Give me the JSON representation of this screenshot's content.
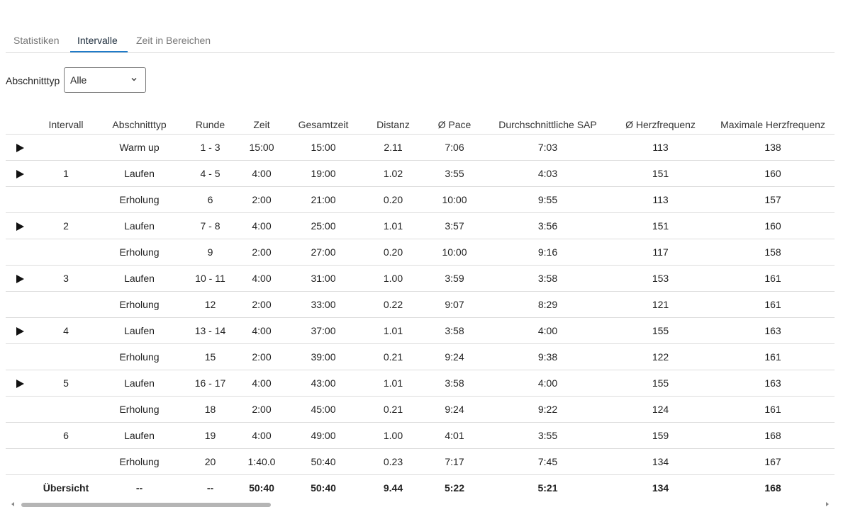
{
  "tabs": [
    {
      "label": "Statistiken",
      "active": false
    },
    {
      "label": "Intervalle",
      "active": true
    },
    {
      "label": "Zeit in Bereichen",
      "active": false
    }
  ],
  "filter": {
    "label": "Abschnitttyp",
    "value": "Alle"
  },
  "table": {
    "headers": [
      "",
      "Intervall",
      "Abschnitttyp",
      "Runde",
      "Zeit",
      "Gesamtzeit",
      "Distanz",
      "Ø Pace",
      "Durchschnittliche SAP",
      "Ø Herzfrequenz",
      "Maximale Herzfrequenz"
    ],
    "rows": [
      {
        "expandable": true,
        "cells": [
          "",
          "Warm up",
          "1 - 3",
          "15:00",
          "15:00",
          "2.11",
          "7:06",
          "7:03",
          "113",
          "138"
        ]
      },
      {
        "expandable": true,
        "cells": [
          "1",
          "Laufen",
          "4 - 5",
          "4:00",
          "19:00",
          "1.02",
          "3:55",
          "4:03",
          "151",
          "160"
        ]
      },
      {
        "expandable": false,
        "cells": [
          "",
          "Erholung",
          "6",
          "2:00",
          "21:00",
          "0.20",
          "10:00",
          "9:55",
          "113",
          "157"
        ]
      },
      {
        "expandable": true,
        "cells": [
          "2",
          "Laufen",
          "7 - 8",
          "4:00",
          "25:00",
          "1.01",
          "3:57",
          "3:56",
          "151",
          "160"
        ]
      },
      {
        "expandable": false,
        "cells": [
          "",
          "Erholung",
          "9",
          "2:00",
          "27:00",
          "0.20",
          "10:00",
          "9:16",
          "117",
          "158"
        ]
      },
      {
        "expandable": true,
        "cells": [
          "3",
          "Laufen",
          "10 - 11",
          "4:00",
          "31:00",
          "1.00",
          "3:59",
          "3:58",
          "153",
          "161"
        ]
      },
      {
        "expandable": false,
        "cells": [
          "",
          "Erholung",
          "12",
          "2:00",
          "33:00",
          "0.22",
          "9:07",
          "8:29",
          "121",
          "161"
        ]
      },
      {
        "expandable": true,
        "cells": [
          "4",
          "Laufen",
          "13 - 14",
          "4:00",
          "37:00",
          "1.01",
          "3:58",
          "4:00",
          "155",
          "163"
        ]
      },
      {
        "expandable": false,
        "cells": [
          "",
          "Erholung",
          "15",
          "2:00",
          "39:00",
          "0.21",
          "9:24",
          "9:38",
          "122",
          "161"
        ]
      },
      {
        "expandable": true,
        "cells": [
          "5",
          "Laufen",
          "16 - 17",
          "4:00",
          "43:00",
          "1.01",
          "3:58",
          "4:00",
          "155",
          "163"
        ]
      },
      {
        "expandable": false,
        "cells": [
          "",
          "Erholung",
          "18",
          "2:00",
          "45:00",
          "0.21",
          "9:24",
          "9:22",
          "124",
          "161"
        ]
      },
      {
        "expandable": false,
        "cells": [
          "6",
          "Laufen",
          "19",
          "4:00",
          "49:00",
          "1.00",
          "4:01",
          "3:55",
          "159",
          "168"
        ]
      },
      {
        "expandable": false,
        "cells": [
          "",
          "Erholung",
          "20",
          "1:40.0",
          "50:40",
          "0.23",
          "7:17",
          "7:45",
          "134",
          "167"
        ]
      }
    ],
    "summary": [
      "Übersicht",
      "--",
      "--",
      "50:40",
      "50:40",
      "9.44",
      "5:22",
      "5:21",
      "134",
      "168"
    ]
  },
  "colors": {
    "accent": "#1f7bc9",
    "border": "#dcdcdc",
    "tab_inactive": "#777777"
  },
  "icons": {
    "expand": "play-triangle-icon",
    "dropdown": "chevron-down-icon"
  }
}
